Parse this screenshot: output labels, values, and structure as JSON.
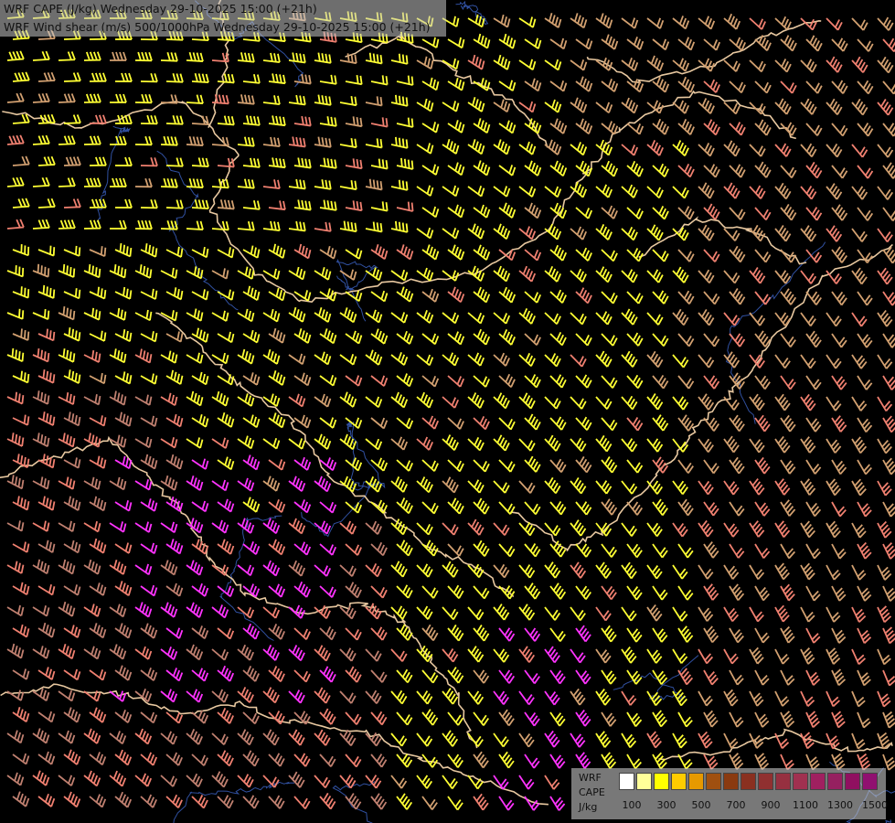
{
  "header": {
    "line1": "WRF CAPE (J/kg) Wednesday 29-10-2025 15:00 (+21h)",
    "line2": "WRF Wind shear (m/s) 500/1000hPa Wednesday 29-10-2025 15:00 (+21h)"
  },
  "legend": {
    "label_model": "WRF",
    "label_field": "CAPE",
    "label_unit": "J/kg",
    "colors": [
      "#ffffff",
      "#ffff99",
      "#ffff00",
      "#ffcc00",
      "#e69900",
      "#a05010",
      "#8a3a10",
      "#8a3020",
      "#903030",
      "#963040",
      "#a03050",
      "#a02060",
      "#962060",
      "#901060",
      "#901070"
    ],
    "ticks": [
      "100",
      "300",
      "500",
      "700",
      "900",
      "1100",
      "1300",
      "1500"
    ]
  },
  "map": {
    "barb_colors": {
      "low": "#ffff33",
      "tan": "#d2a070",
      "salmon": "#f08070",
      "magenta": "#ff33ff",
      "brown": "#c08070"
    },
    "border_color": "#e8c8a0",
    "river_color": "#3050a0"
  }
}
